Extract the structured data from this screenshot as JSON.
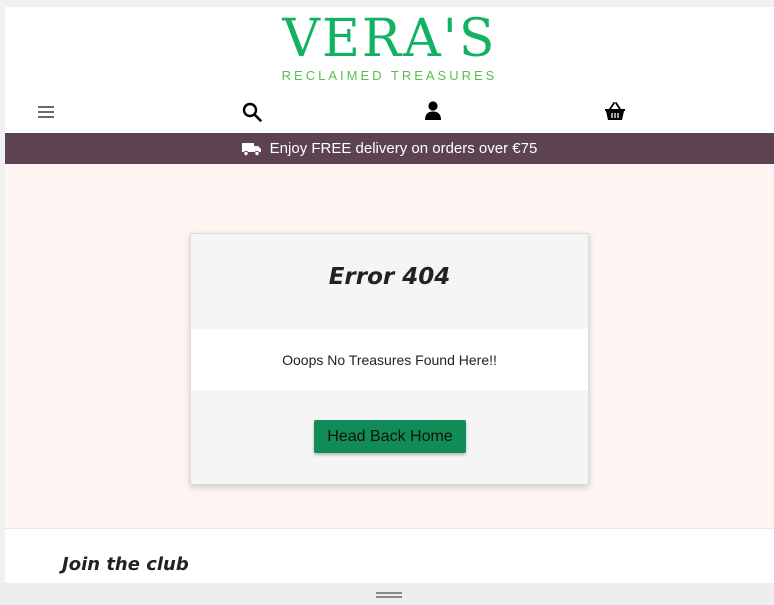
{
  "brand": {
    "title": "VERA'S",
    "subtitle": "RECLAIMED TREASURES"
  },
  "nav": {
    "icons": [
      "menu-icon",
      "search-icon",
      "user-icon",
      "basket-icon"
    ]
  },
  "banner": {
    "text": "Enjoy FREE delivery on orders over €75",
    "icon": "truck-icon"
  },
  "error": {
    "title": "Error 404",
    "message": "Ooops No Treasures Found Here!!",
    "button_label": "Head Back Home"
  },
  "footer": {
    "join_heading": "Join the club"
  },
  "colors": {
    "brand_green": "#12b263",
    "banner_bg": "#5d4352",
    "main_bg": "#fef4f1",
    "button_bg": "#118b57"
  }
}
